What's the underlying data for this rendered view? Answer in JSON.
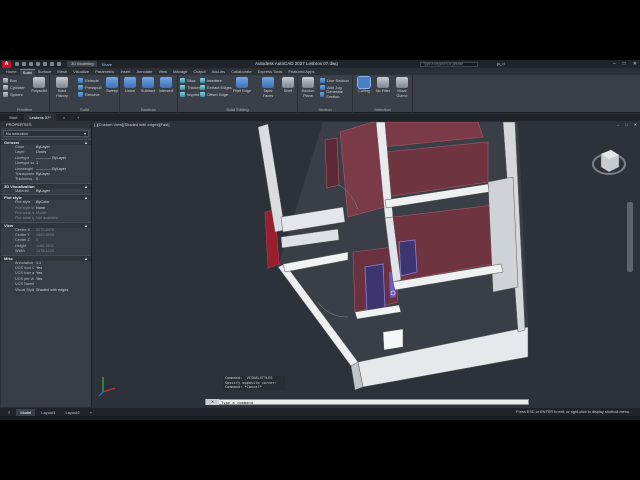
{
  "app": {
    "logo": "A",
    "workspace": "3D Modeling",
    "share": "Share",
    "title": "Autodesk AutoCAD 2027   Lesbros 07.dwg",
    "search_placeholder": "Type a keyword or phrase",
    "user": "jo_d",
    "window_buttons": [
      "–",
      "□",
      "✕"
    ]
  },
  "ribbon_tabs": [
    "Home",
    "Solid",
    "Surface",
    "Mesh",
    "Visualize",
    "Parametric",
    "Insert",
    "Annotate",
    "View",
    "Manage",
    "Output",
    "Add-ins",
    "Collaborate",
    "Express Tools",
    "Featured Apps"
  ],
  "ribbon": {
    "primitive": {
      "title": "Primitive",
      "items": [
        "Box",
        "Cylinder",
        "Sphere"
      ],
      "big": [
        "Polysolid"
      ]
    },
    "solid": {
      "title": "Solid",
      "big": [
        "Solid History"
      ],
      "items": [
        "Extrude",
        "Presspull",
        "Revolve"
      ],
      "more": [
        "Sweep",
        "Loft"
      ]
    },
    "boolean": {
      "title": "Boolean",
      "big": [
        "Union",
        "Subtract",
        "Intersect"
      ]
    },
    "solid_editing": {
      "title": "Solid Editing",
      "items": [
        "Slice",
        "Thicken",
        "Imprint",
        "Interfere",
        "Extract Edges",
        "Offset Edge"
      ],
      "big": [
        "Fillet Edge",
        "Taper Faces",
        "Shell"
      ]
    },
    "section": {
      "title": "Section",
      "big": [
        "Section Plane"
      ],
      "items": [
        "Live Section",
        "Add Jog",
        "Generate Section"
      ]
    },
    "selection": {
      "title": "Selection",
      "big": [
        "Culling",
        "No Filter",
        "Move Gizmo"
      ]
    }
  },
  "doc_tabs": [
    "Start",
    "Lesbros 07*"
  ],
  "properties": {
    "title": "PROPERTIES",
    "selection": "No selection",
    "sections": [
      {
        "name": "General",
        "rows": [
          [
            "Color",
            "ByLayer"
          ],
          [
            "Layer",
            "Doors"
          ],
          [
            "Linetype",
            "———— ByLayer"
          ],
          [
            "Linetype scale",
            "1"
          ],
          [
            "Lineweight",
            "———— ByLayer"
          ],
          [
            "Transparency",
            "ByLayer"
          ],
          [
            "Thickness",
            "0"
          ]
        ]
      },
      {
        "name": "3D Visualization",
        "rows": [
          [
            "Material",
            "ByLayer"
          ]
        ]
      },
      {
        "name": "Plot style",
        "rows": [
          [
            "Plot style",
            "ByColor"
          ],
          [
            "Plot style table",
            "None"
          ],
          [
            "Plot table attac...",
            "Model"
          ],
          [
            "Plot table type",
            "Not available"
          ]
        ]
      },
      {
        "name": "View",
        "rows": [
          [
            "Center X",
            "2070.8976"
          ],
          [
            "Center Y",
            "1563.8590"
          ],
          [
            "Center Z",
            "0"
          ],
          [
            "Height",
            "1164.3802"
          ],
          [
            "Width",
            "1478.1029"
          ]
        ]
      },
      {
        "name": "Misc",
        "rows": [
          [
            "Annotation sca...",
            "1:1"
          ],
          [
            "UCS icon On",
            "Yes"
          ],
          [
            "UCS icon at ori...",
            "Yes"
          ],
          [
            "UCS per viewp...",
            "Yes"
          ],
          [
            "UCS Name",
            ""
          ],
          [
            "Visual Style",
            "Shaded with edges"
          ]
        ]
      }
    ]
  },
  "viewport": {
    "label": "[-][Custom View][Shaded with edges][Fast]",
    "win_buttons": [
      "–",
      "□",
      "✕"
    ]
  },
  "command": {
    "history": [
      "Command: _VISUALSTYLES",
      "Specify opposite corner:",
      "Command: *Cancel*"
    ],
    "prompt_placeholder": "Type a command"
  },
  "layout_tabs": [
    "Model",
    "Layout1",
    "Layout2"
  ],
  "status_text": "Press ESC or ENTER to exit, or right-click to display shortcut menu."
}
